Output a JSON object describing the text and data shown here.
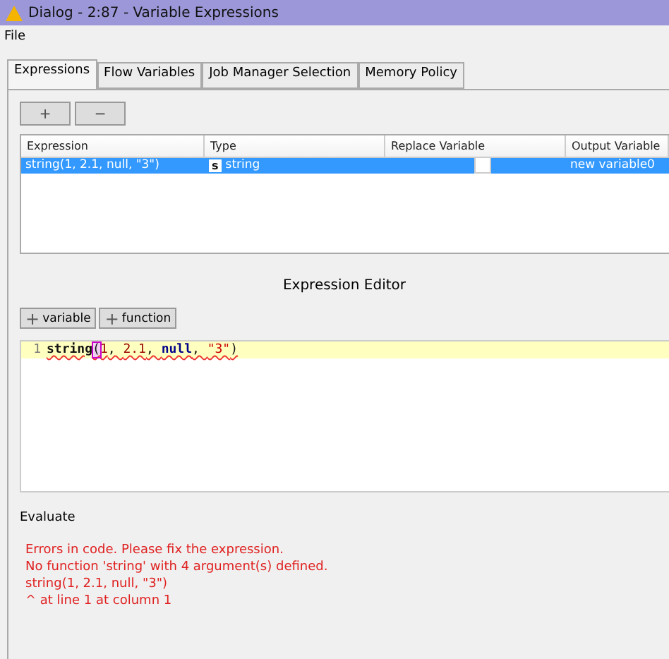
{
  "window": {
    "title": "Dialog - 2:87 - Variable Expressions"
  },
  "menu": [
    "File"
  ],
  "tabs": [
    {
      "label": "Expressions",
      "selected": true
    },
    {
      "label": "Flow Variables",
      "selected": false
    },
    {
      "label": "Job Manager Selection",
      "selected": false
    },
    {
      "label": "Memory Policy",
      "selected": false
    }
  ],
  "toolbar": [
    "+",
    "−"
  ],
  "table": {
    "columns": [
      "Expression",
      "Type",
      "Replace Variable",
      "Output Variable"
    ],
    "rows": [
      {
        "expression": "string(1, 2.1, null, \"3\")",
        "type_icon": "s",
        "type": "string",
        "replace": false,
        "output": "new variable0",
        "selected": true
      }
    ]
  },
  "editor_title": "Expression Editor",
  "editor_buttons": [
    {
      "icon": "+",
      "label": "variable"
    },
    {
      "icon": "+",
      "label": "function"
    }
  ],
  "editor": {
    "line_number": "1",
    "tokens": [
      {
        "text": "string",
        "kind": "func"
      },
      {
        "text": "(",
        "kind": "bracket"
      },
      {
        "text": "1",
        "kind": "number"
      },
      {
        "text": ", ",
        "kind": "plain"
      },
      {
        "text": "2.1",
        "kind": "number"
      },
      {
        "text": ", ",
        "kind": "plain"
      },
      {
        "text": "null",
        "kind": "keyword"
      },
      {
        "text": ", ",
        "kind": "plain"
      },
      {
        "text": "\"3\"",
        "kind": "string"
      },
      {
        "text": ")",
        "kind": "plain"
      }
    ]
  },
  "evaluate_label": "Evaluate",
  "errors": [
    "Errors in code. Please fix the expression.",
    "No function 'string' with 4 argument(s) defined.",
    "string(1, 2.1, null, \"3\")",
    "^ at line 1 at column 1"
  ]
}
